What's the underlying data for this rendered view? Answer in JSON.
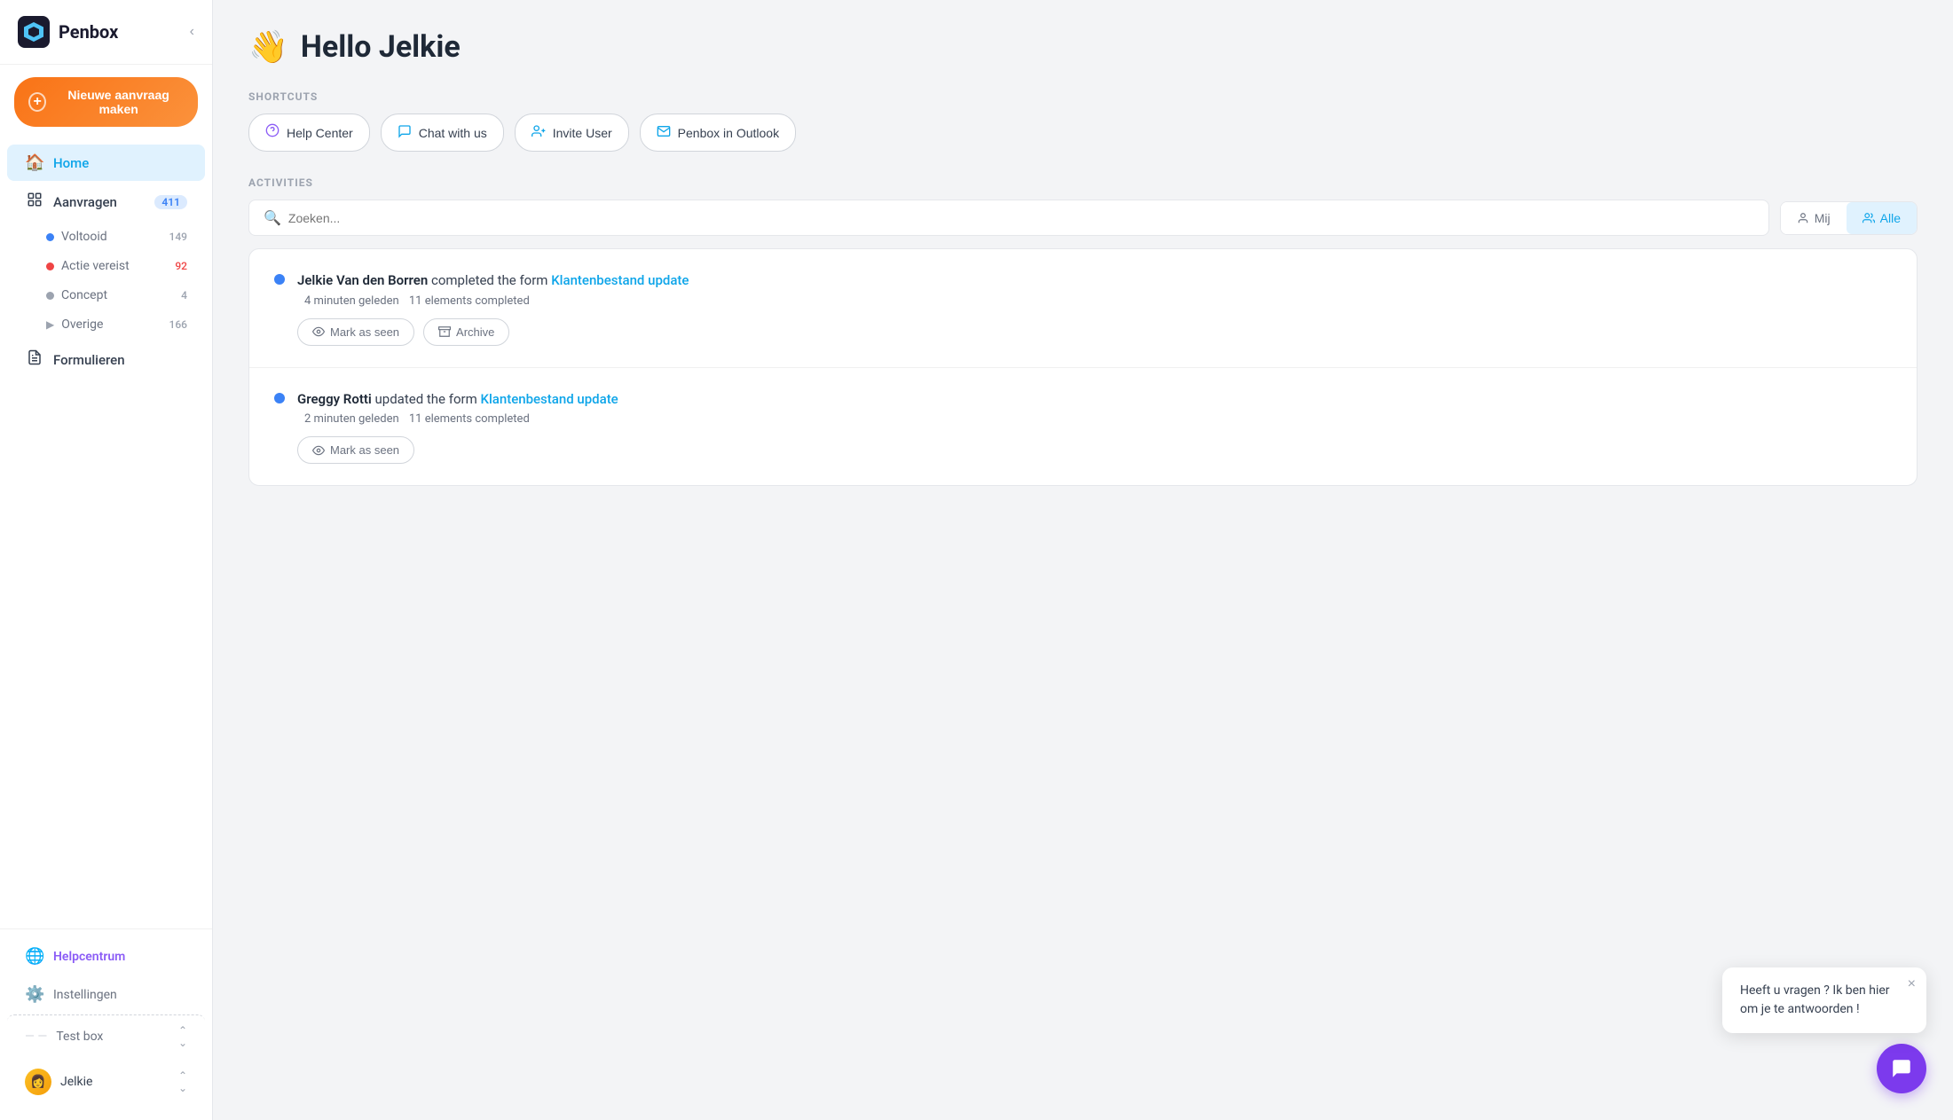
{
  "app": {
    "name": "Penbox"
  },
  "sidebar": {
    "collapse_label": "‹",
    "new_request_label": "Nieuwe aanvraag maken",
    "nav_items": [
      {
        "id": "home",
        "label": "Home",
        "icon": "🏠",
        "active": true
      },
      {
        "id": "aanvragen",
        "label": "Aanvragen",
        "icon": "📋",
        "badge": "411",
        "badge_color": "blue"
      }
    ],
    "subnav_items": [
      {
        "id": "voltooid",
        "label": "Voltooid",
        "dot": "blue",
        "badge": "149"
      },
      {
        "id": "actie-vereist",
        "label": "Actie vereist",
        "dot": "red",
        "badge": "92"
      },
      {
        "id": "concept",
        "label": "Concept",
        "dot": "gray",
        "badge": "4"
      },
      {
        "id": "overige",
        "label": "Overige",
        "dot": "none",
        "badge": "166",
        "has_arrow": true
      }
    ],
    "formulieren_label": "Formulieren",
    "formulieren_icon": "📄",
    "bottom_items": [
      {
        "id": "helpcentrum",
        "label": "Helpcentrum",
        "icon": "🌐",
        "color": "purple"
      },
      {
        "id": "instellingen",
        "label": "Instellingen",
        "icon": "⚙️"
      }
    ],
    "test_box_label": "Test box",
    "user_label": "Jelkie"
  },
  "page": {
    "greeting_emoji": "👋",
    "title": "Hello Jelkie"
  },
  "shortcuts": {
    "label": "SHORTCUTS",
    "buttons": [
      {
        "id": "help-center",
        "label": "Help Center",
        "icon": "help"
      },
      {
        "id": "chat-with-us",
        "label": "Chat with us",
        "icon": "chat"
      },
      {
        "id": "invite-user",
        "label": "Invite User",
        "icon": "invite"
      },
      {
        "id": "penbox-outlook",
        "label": "Penbox in Outlook",
        "icon": "mail"
      }
    ]
  },
  "activities": {
    "label": "ACTIVITIES",
    "search_placeholder": "Zoeken...",
    "filter_mij": "Mij",
    "filter_alle": "Alle",
    "items": [
      {
        "id": "activity-1",
        "user": "Jelkie Van den Borren",
        "action": "completed the form",
        "form_name": "Klantenbestand update",
        "time": "4 minuten geleden",
        "elements": "11 elements completed",
        "actions": [
          "Mark as seen",
          "Archive"
        ]
      },
      {
        "id": "activity-2",
        "user": "Greggy Rotti",
        "action": "updated the form",
        "form_name": "Klantenbestand update",
        "time": "2 minuten geleden",
        "elements": "11 elements completed",
        "actions": [
          "Mark as seen"
        ]
      }
    ]
  },
  "chat_widget": {
    "tooltip_text": "Heeft u vragen ? Ik ben hier om je te antwoorden !",
    "close_label": "×"
  }
}
